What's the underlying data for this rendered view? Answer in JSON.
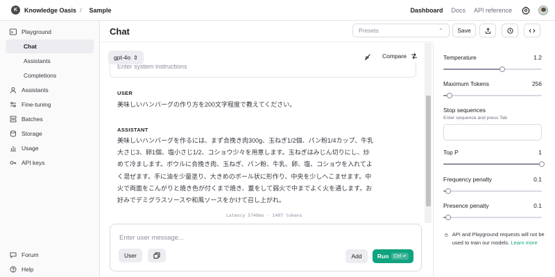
{
  "topbar": {
    "org_initial": "K",
    "org_name": "Knowledge Oasis",
    "separator": "/",
    "project": "Sample",
    "nav": [
      "Dashboard",
      "Docs",
      "API reference"
    ]
  },
  "sidebar": {
    "items": [
      {
        "label": "Playground",
        "icon": "playground-icon"
      },
      {
        "label": "Chat",
        "sub": true,
        "active": true
      },
      {
        "label": "Assistants",
        "sub": true
      },
      {
        "label": "Completions",
        "sub": true
      },
      {
        "label": "Assistants",
        "icon": "assistants-icon"
      },
      {
        "label": "Fine-tuning",
        "icon": "fine-tuning-icon"
      },
      {
        "label": "Batches",
        "icon": "batches-icon"
      },
      {
        "label": "Storage",
        "icon": "storage-icon"
      },
      {
        "label": "Usage",
        "icon": "usage-icon"
      },
      {
        "label": "API keys",
        "icon": "key-icon"
      }
    ],
    "bottom": [
      {
        "label": "Forum",
        "icon": "forum-icon"
      },
      {
        "label": "Help",
        "icon": "help-icon"
      }
    ]
  },
  "header": {
    "title": "Chat",
    "presets_placeholder": "Presets",
    "save_label": "Save"
  },
  "chat": {
    "model": "gpt-4o",
    "compare_label": "Compare",
    "system_placeholder": "Enter system instructions",
    "messages": [
      {
        "role": "USER",
        "text": "美味しいハンバーグの作り方を200文字程度で教えてください。"
      },
      {
        "role": "ASSISTANT",
        "lines": [
          "美味しいハンバーグを作るには、まず合挽き肉300g、玉ねぎ1/2個、パン粉1/4カップ、牛乳",
          "大さじ3、卵1個、塩小さじ1/2、コショウ少々を用意します。玉ねぎはみじん切りにし、炒",
          "めて冷まします。ボウルに合挽き肉、玉ねぎ、パン粉、牛乳、卵、塩、コショウを入れてよ",
          "く混ぜます。手に油を少量塗り、大きめのボール状に形作り、中央を少しへこませます。中",
          "火で両面をこんがりと焼き色が付くまで焼き、蓋をして弱火で中までよく火を通します。お",
          "好みでデミグラスソースや和風ソースをかけて召し上がれ。"
        ]
      }
    ],
    "latency": "Latency 5748ms · 1497 tokens"
  },
  "composer": {
    "placeholder": "Enter user message...",
    "role_label": "User",
    "add_label": "Add",
    "run_label": "Run",
    "run_shortcut": "Ctrl ↵"
  },
  "params": {
    "temperature": {
      "label": "Temperature",
      "value": "1.2",
      "fraction": 0.6
    },
    "max_tokens": {
      "label": "Maximum Tokens",
      "value": "256",
      "fraction": 0.06
    },
    "stop": {
      "label": "Stop sequences",
      "hint": "Enter sequence and press Tab"
    },
    "top_p": {
      "label": "Top P",
      "value": "1",
      "fraction": 1.0
    },
    "frequency_penalty": {
      "label": "Frequency penalty",
      "value": "0.1",
      "fraction": 0.05
    },
    "presence_penalty": {
      "label": "Presence penalty",
      "value": "0.1",
      "fraction": 0.05
    }
  },
  "notice": {
    "text": "API and Playground requests will not be used to train our models.",
    "link": "Learn more"
  },
  "colors": {
    "accent": "#10a37f",
    "sidebar_bg": "#fafafa",
    "active_item_bg": "#ececf1"
  }
}
